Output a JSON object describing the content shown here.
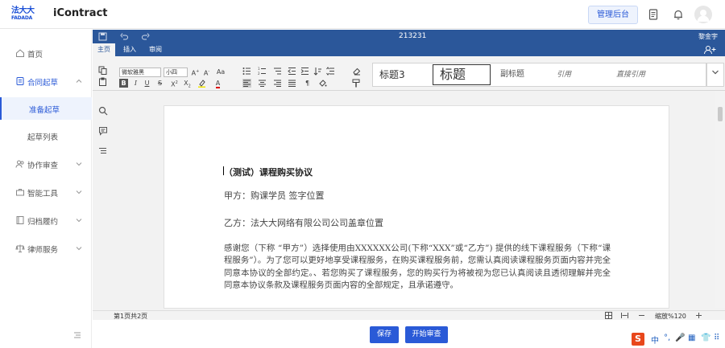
{
  "header": {
    "logo_cn": "法大大",
    "logo_en": "FADADA",
    "app_name": "iContract",
    "admin_label": "管理后台"
  },
  "sidebar": {
    "items": [
      {
        "label": "首页"
      },
      {
        "label": "合同起草"
      },
      {
        "label": "准备起草"
      },
      {
        "label": "起草列表"
      },
      {
        "label": "协作审查"
      },
      {
        "label": "智能工具"
      },
      {
        "label": "归档履约"
      },
      {
        "label": "律师服务"
      }
    ]
  },
  "editor": {
    "doc_title": "213231",
    "user_name": "黎金宇",
    "tabs": [
      "主页",
      "插入",
      "审阅"
    ],
    "font_name": "微软雅黑",
    "font_size": "小四",
    "styles": [
      "标题3",
      "标题",
      "副标题",
      "引用",
      "直接引用"
    ],
    "status_page": "第1页共2页",
    "zoom": "缩放%120"
  },
  "document": {
    "heading": "（测试）课程购买协议",
    "party_a": "甲方：购课学员  签字位置",
    "party_b": "乙方：法大大网络有限公司公司盖章位置",
    "paragraph": "感谢您（下称 “甲方”）选择使用由XXXXXX公司(下称“XXX”或“乙方”) 提供的线下课程服务（下称“课程服务”）。为了您可以更好地享受课程服务，在购买课程服务前，您需认真阅读课程服务页面内容并完全同意本协议的全部约定。、若您购买了课程服务，您的购买行为将被视为您已认真阅读且透彻理解并完全同意本协议条款及课程服务页面内容的全部规定，且承诺遵守。"
  },
  "footer": {
    "save_label": "保存",
    "review_label": "开始审查"
  },
  "ime": {
    "items": [
      "中",
      "°,",
      "🎤",
      "▦",
      "👕",
      "⠿"
    ]
  },
  "colors": {
    "accent": "#2a5ad7",
    "ribbon": "#2b579a"
  }
}
